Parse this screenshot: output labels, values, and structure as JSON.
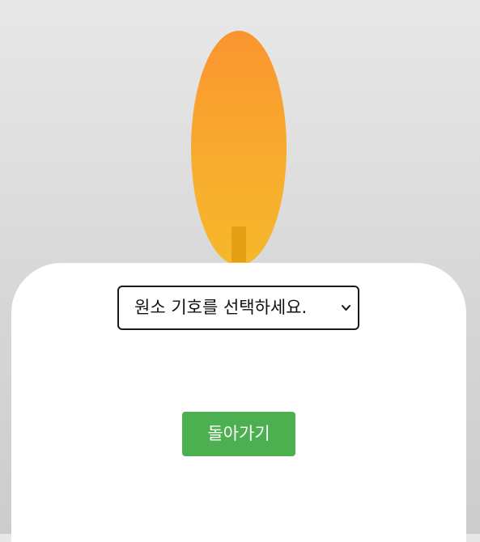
{
  "candle": {
    "flame_color_top": "#fa9530",
    "flame_color_bottom": "#f6b82c",
    "wick_color": "#e59f14",
    "body_color": "#ffffff"
  },
  "element_select": {
    "selected_label": "원소 기호를 선택하세요.",
    "icon": "chevron-down-icon"
  },
  "back_button": {
    "label": "돌아가기",
    "color": "#4caf50"
  }
}
